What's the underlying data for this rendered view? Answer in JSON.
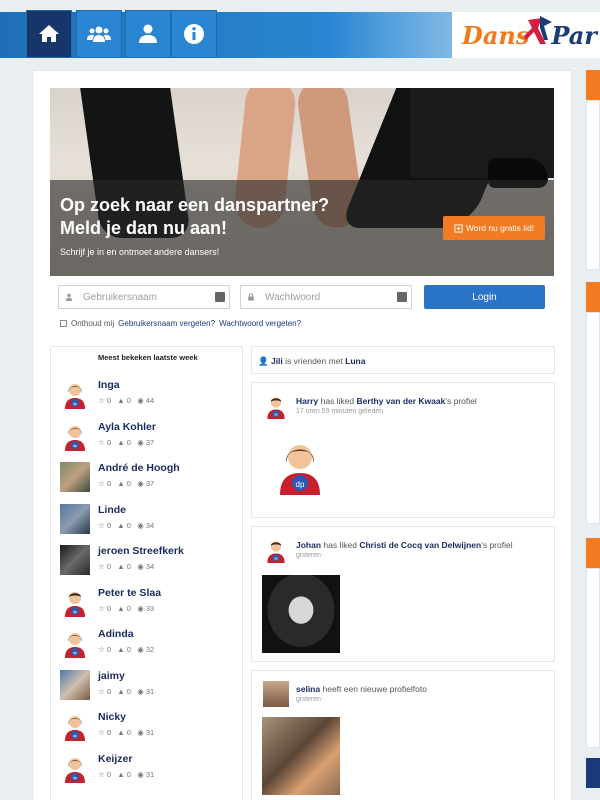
{
  "nav": {
    "items": [
      {
        "icon": "home-icon",
        "active": true
      },
      {
        "icon": "users-group-icon",
        "active": false
      },
      {
        "icon": "user-icon",
        "active": false
      },
      {
        "icon": "info-icon",
        "active": false
      }
    ],
    "logo_part1": "Dans",
    "logo_part2": "Par"
  },
  "hero": {
    "title_line1": "Op zoek naar een danspartner?",
    "title_line2": "Meld je dan nu aan!",
    "subtitle": "Schrijf je in en ontmoet andere dansers!",
    "cta_label": "Word nu gratis lid!"
  },
  "login": {
    "username_placeholder": "Gebruikersnaam",
    "password_placeholder": "Wachtwoord",
    "button_label": "Login",
    "remember_label": "Onthoud mij",
    "forgot_username": "Gebruikersnaam vergeten?",
    "forgot_password": "Wachtwoord vergeten?"
  },
  "most_viewed": {
    "title": "Meest bekeken laatste week",
    "users": [
      {
        "name": "Inga",
        "stars": "0",
        "likes": "0",
        "views": "44",
        "avatar": "default"
      },
      {
        "name": "Ayla Kohler",
        "stars": "0",
        "likes": "0",
        "views": "37",
        "avatar": "default"
      },
      {
        "name": "André de Hoogh",
        "stars": "0",
        "likes": "0",
        "views": "37",
        "avatar": "photo"
      },
      {
        "name": "Linde",
        "stars": "0",
        "likes": "0",
        "views": "34",
        "avatar": "photo"
      },
      {
        "name": "jeroen Streefkerk",
        "stars": "0",
        "likes": "0",
        "views": "34",
        "avatar": "photo"
      },
      {
        "name": "Peter te Slaa",
        "stars": "0",
        "likes": "0",
        "views": "33",
        "avatar": "default-male"
      },
      {
        "name": "Adinda",
        "stars": "0",
        "likes": "0",
        "views": "32",
        "avatar": "default"
      },
      {
        "name": "jaimy",
        "stars": "0",
        "likes": "0",
        "views": "31",
        "avatar": "photo"
      },
      {
        "name": "Nicky",
        "stars": "0",
        "likes": "0",
        "views": "31",
        "avatar": "default"
      },
      {
        "name": "Keijzer",
        "stars": "0",
        "likes": "0",
        "views": "31",
        "avatar": "default"
      }
    ]
  },
  "feed": {
    "friend": {
      "user1": "Jili",
      "middle": "is vrienden met",
      "user2": "Luna"
    },
    "posts": [
      {
        "user": "Harry",
        "action": "has liked",
        "target": "Berthy van der Kwaak",
        "suffix": "'s profiel",
        "time": "17 uren 59 minuten geleden"
      },
      {
        "user": "Johan",
        "action": "has liked",
        "target": "Christi de Cocq van Delwijnen",
        "suffix": "'s profiel",
        "time": "gisteren"
      },
      {
        "user": "selina",
        "action": "heeft een nieuwe profielfoto",
        "target": "",
        "suffix": "",
        "time": "gisteren"
      }
    ]
  },
  "colors": {
    "brand_blue": "#2a86d2",
    "nav_active": "#15356b",
    "accent_orange": "#f27b22",
    "name_navy": "#1a2a5e"
  }
}
